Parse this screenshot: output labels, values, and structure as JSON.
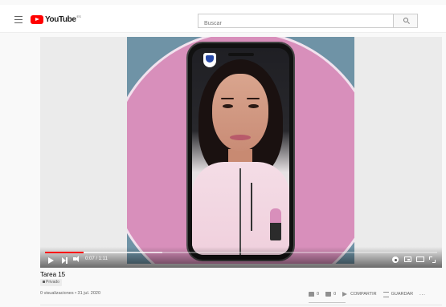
{
  "header": {
    "logo_text": "YouTube",
    "region": "ES",
    "search_placeholder": "Buscar"
  },
  "player": {
    "time": "0:07 / 1:11",
    "progress_fraction": 0.099,
    "buffer_fraction": 0.3
  },
  "video": {
    "title": "Tarea 15",
    "privacy": "Privado",
    "views_date": "0 visualizaciones • 31 jul. 2020"
  },
  "actions": {
    "like_count": "0",
    "dislike_count": "0",
    "share_label": "COMPARTIR",
    "save_label": "GUARDAR",
    "more_label": "..."
  },
  "colors": {
    "accent": "#ff0000",
    "background": "#f9f9f9"
  }
}
